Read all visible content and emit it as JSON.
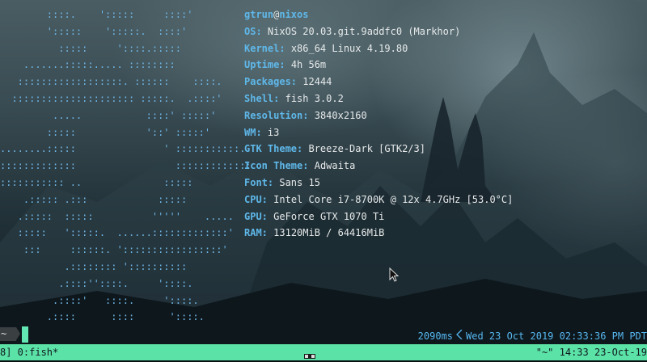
{
  "logo_lines": [
    "        ::::.    ':::::     ::::'",
    "        ':::::    ':::::.  ::::'",
    "          :::::     '::::.:::::",
    "    .......:::::..... ::::::::",
    "   ::::::::::::::::::. ::::::    ::::.",
    "  ::::::::::::::::::::: :::::.  .::::'",
    "         .....           ::::' :::::'",
    "        :::::            '::' :::::'",
    "........:::::               ' :::::::::::.",
    ":::::::::::::                 :::::::::::::",
    "::::::::::: ..              :::::",
    "    .::::: .:::            :::::",
    "   .:::::  :::::          '''''    .....",
    "   :::::   ':::::.  ......:::::::::::::'",
    "    :::     ::::::. ':::::::::::::::::'",
    "           .:::::::: '::::::::::",
    "          .::::''::::.     '::::.",
    "         .::::'   ::::.     '::::.",
    "        .::::      ::::      '::::."
  ],
  "fetch": {
    "user": "gtrun",
    "at": "@",
    "host": "nixos",
    "rows": [
      {
        "key": "OS:",
        "value": "NixOS 20.03.git.9addfc0 (Markhor)"
      },
      {
        "key": "Kernel:",
        "value": "x86_64 Linux 4.19.80"
      },
      {
        "key": "Uptime:",
        "value": "4h 56m"
      },
      {
        "key": "Packages:",
        "value": "12444"
      },
      {
        "key": "Shell:",
        "value": "fish 3.0.2"
      },
      {
        "key": "Resolution:",
        "value": "3840x2160"
      },
      {
        "key": "WM:",
        "value": "i3"
      },
      {
        "key": "GTK Theme:",
        "value": "Breeze-Dark [GTK2/3]"
      },
      {
        "key": "Icon Theme:",
        "value": "Adwaita"
      },
      {
        "key": "Font:",
        "value": "Sans 15"
      },
      {
        "key": "CPU:",
        "value": "Intel Core i7-8700K @ 12x 4.7GHz [53.0°C]"
      },
      {
        "key": "GPU:",
        "value": "GeForce GTX 1070 Ti"
      },
      {
        "key": "RAM:",
        "value": "13120MiB / 64416MiB"
      }
    ]
  },
  "prompt": {
    "cwd": "~",
    "duration": "2090ms",
    "datetime": "Wed 23 Oct 2019 02:33:36 PM PDT"
  },
  "tmux": {
    "left": "8] 0:fish*",
    "right": "\"~\" 14:33 23-Oct-19"
  },
  "colors": {
    "logo": "#6fb6e6",
    "key": "#5fb8ea",
    "text": "#e6e9ea",
    "cursor": "#62e6b3",
    "tmux_bar": "#5be2a6",
    "right_prompt": "#57b7f0"
  },
  "icons": {
    "mouse": "mouse-pointer-icon",
    "chevron": "chevron-left-icon"
  }
}
